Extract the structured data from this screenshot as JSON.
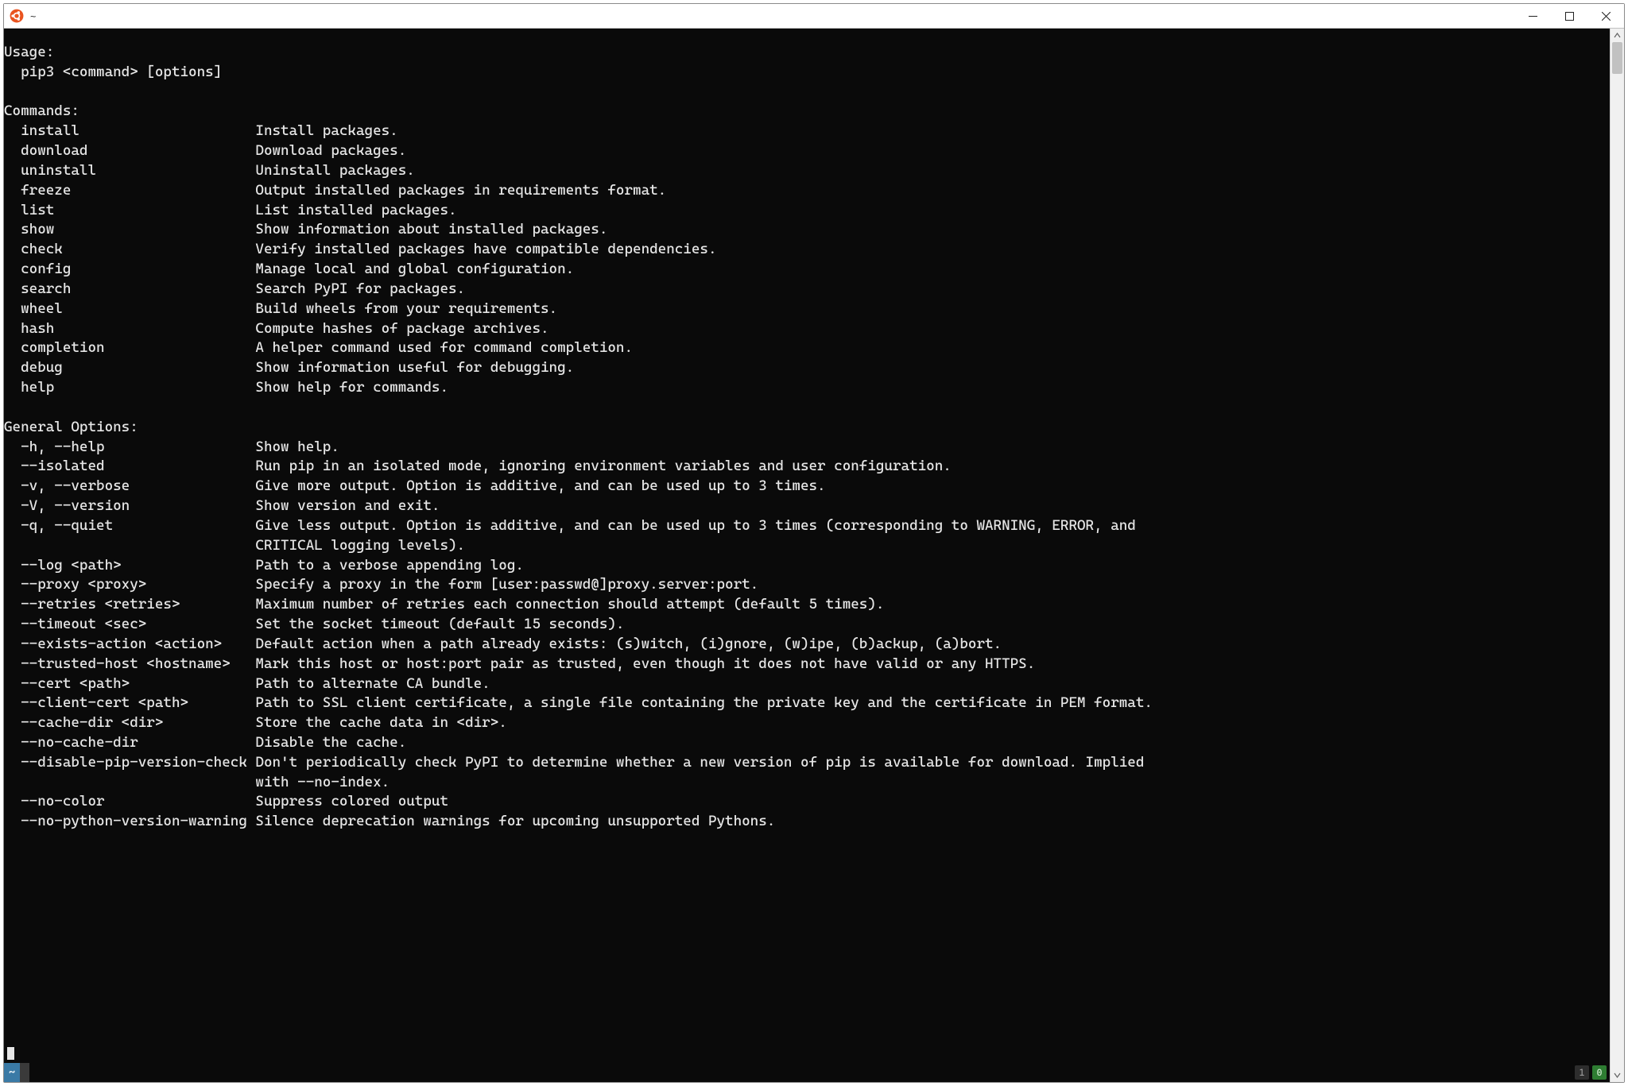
{
  "window": {
    "title": "~",
    "min_tooltip": "Minimize",
    "max_tooltip": "Maximize",
    "close_tooltip": "Close"
  },
  "terminal": {
    "usage_header": "Usage:",
    "usage_line": "  pip3 <command> [options]",
    "commands_header": "Commands:",
    "commands": [
      {
        "name": "install",
        "desc": "Install packages."
      },
      {
        "name": "download",
        "desc": "Download packages."
      },
      {
        "name": "uninstall",
        "desc": "Uninstall packages."
      },
      {
        "name": "freeze",
        "desc": "Output installed packages in requirements format."
      },
      {
        "name": "list",
        "desc": "List installed packages."
      },
      {
        "name": "show",
        "desc": "Show information about installed packages."
      },
      {
        "name": "check",
        "desc": "Verify installed packages have compatible dependencies."
      },
      {
        "name": "config",
        "desc": "Manage local and global configuration."
      },
      {
        "name": "search",
        "desc": "Search PyPI for packages."
      },
      {
        "name": "wheel",
        "desc": "Build wheels from your requirements."
      },
      {
        "name": "hash",
        "desc": "Compute hashes of package archives."
      },
      {
        "name": "completion",
        "desc": "A helper command used for command completion."
      },
      {
        "name": "debug",
        "desc": "Show information useful for debugging."
      },
      {
        "name": "help",
        "desc": "Show help for commands."
      }
    ],
    "general_header": "General Options:",
    "options": [
      {
        "flag": "-h, --help",
        "desc": "Show help."
      },
      {
        "flag": "--isolated",
        "desc": "Run pip in an isolated mode, ignoring environment variables and user configuration."
      },
      {
        "flag": "-v, --verbose",
        "desc": "Give more output. Option is additive, and can be used up to 3 times."
      },
      {
        "flag": "-V, --version",
        "desc": "Show version and exit."
      },
      {
        "flag": "-q, --quiet",
        "desc": "Give less output. Option is additive, and can be used up to 3 times (corresponding to WARNING, ERROR, and CRITICAL logging levels)."
      },
      {
        "flag": "--log <path>",
        "desc": "Path to a verbose appending log."
      },
      {
        "flag": "--proxy <proxy>",
        "desc": "Specify a proxy in the form [user:passwd@]proxy.server:port."
      },
      {
        "flag": "--retries <retries>",
        "desc": "Maximum number of retries each connection should attempt (default 5 times)."
      },
      {
        "flag": "--timeout <sec>",
        "desc": "Set the socket timeout (default 15 seconds)."
      },
      {
        "flag": "--exists-action <action>",
        "desc": "Default action when a path already exists: (s)witch, (i)gnore, (w)ipe, (b)ackup, (a)bort."
      },
      {
        "flag": "--trusted-host <hostname>",
        "desc": "Mark this host or host:port pair as trusted, even though it does not have valid or any HTTPS."
      },
      {
        "flag": "--cert <path>",
        "desc": "Path to alternate CA bundle."
      },
      {
        "flag": "--client-cert <path>",
        "desc": "Path to SSL client certificate, a single file containing the private key and the certificate in PEM format."
      },
      {
        "flag": "--cache-dir <dir>",
        "desc": "Store the cache data in <dir>."
      },
      {
        "flag": "--no-cache-dir",
        "desc": "Disable the cache."
      },
      {
        "flag": "--disable-pip-version-check",
        "desc": "Don't periodically check PyPI to determine whether a new version of pip is available for download. Implied with --no-index."
      },
      {
        "flag": "--no-color",
        "desc": "Suppress colored output"
      },
      {
        "flag": "--no-python-version-warning",
        "desc": "Silence deprecation warnings for upcoming unsupported Pythons."
      }
    ],
    "prompt_line": "   ",
    "status": {
      "left_seg1": "~",
      "left_seg2": "",
      "right_badge1": "1",
      "right_badge2": "0"
    },
    "layout": {
      "col1_width": 28,
      "indent": 2,
      "wrap_width": 110
    }
  }
}
